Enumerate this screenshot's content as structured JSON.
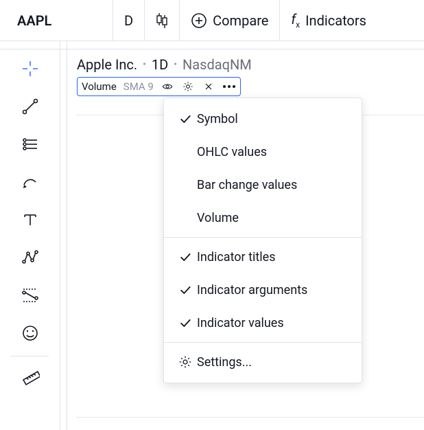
{
  "topbar": {
    "ticker": "AAPL",
    "interval": "D",
    "compare_label": "Compare",
    "indicators_label": "Indicators"
  },
  "header": {
    "company": "Apple Inc.",
    "timeframe": "1D",
    "exchange": "NasdaqNM"
  },
  "indicator_chip": {
    "title": "Volume",
    "args": "SMA 9"
  },
  "menu": {
    "items": [
      {
        "label": "Symbol",
        "checked": true
      },
      {
        "label": "OHLC values",
        "checked": false
      },
      {
        "label": "Bar change values",
        "checked": false
      },
      {
        "label": "Volume",
        "checked": false
      }
    ],
    "items2": [
      {
        "label": "Indicator titles",
        "checked": true
      },
      {
        "label": "Indicator arguments",
        "checked": true
      },
      {
        "label": "Indicator values",
        "checked": true
      }
    ],
    "settings_label": "Settings..."
  },
  "tools": [
    "crosshair-icon",
    "trendline-icon",
    "lines-icon",
    "brush-icon",
    "text-icon",
    "pattern-icon",
    "forecast-icon",
    "emoji-icon",
    "ruler-icon"
  ]
}
